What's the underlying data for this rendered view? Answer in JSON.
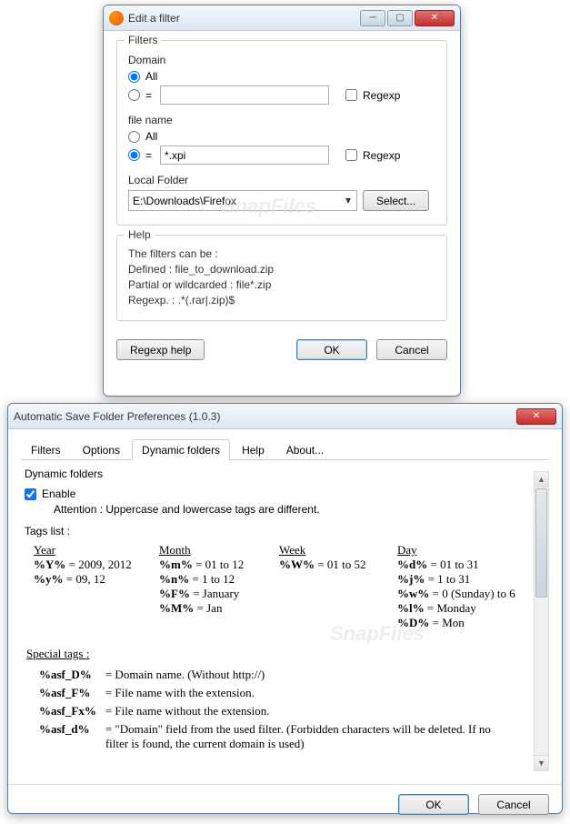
{
  "window1": {
    "title": "Edit a filter",
    "fieldset": "Filters",
    "domain_label": "Domain",
    "radio_all": "All",
    "domain_value": "",
    "regexp_label": "Regexp",
    "filename_label": "file name",
    "filename_value": "*.xpi",
    "folder_label": "Local Folder",
    "folder_value": "E:\\Downloads\\Firefox",
    "select_btn": "Select...",
    "help_legend": "Help",
    "help1": "The filters can be :",
    "help2": "Defined : file_to_download.zip",
    "help3": "Partial or wildcarded : file*.zip",
    "help4": "Regexp. : .*(.rar|.zip)$",
    "regexp_help_btn": "Regexp help",
    "ok": "OK",
    "cancel": "Cancel"
  },
  "window2": {
    "title": "Automatic Save Folder Preferences (1.0.3)",
    "tabs": [
      "Filters",
      "Options",
      "Dynamic folders",
      "Help",
      "About..."
    ],
    "active_tab": 2,
    "content_title": "Dynamic folders",
    "enable": "Enable",
    "attention": "Attention : Uppercase and lowercase tags are different.",
    "tags_list": "Tags list :",
    "year_head": "Year",
    "year_lines": [
      "%Y% = 2009, 2012",
      "%y% = 09, 12"
    ],
    "month_head": "Month",
    "month_lines": [
      "%m% = 01 to 12",
      "%n% = 1 to 12",
      "%F% = January",
      "%M% = Jan"
    ],
    "week_head": "Week",
    "week_lines": [
      "%W% = 01 to 52"
    ],
    "day_head": "Day",
    "day_lines": [
      "%d% = 01 to 31",
      "%j% = 1 to 31",
      "%w% = 0 (Sunday) to 6",
      "%l% = Monday",
      "%D% = Mon"
    ],
    "special_head": "Special tags :",
    "special": [
      {
        "tag": "%asf_D%",
        "desc": "= Domain name. (Without http://)"
      },
      {
        "tag": "%asf_F%",
        "desc": "= File name with the extension."
      },
      {
        "tag": "%asf_Fx%",
        "desc": "= File name without the extension."
      },
      {
        "tag": "%asf_d%",
        "desc": "= \"Domain\" field from the used filter. (Forbidden characters will be deleted. If no filter is found, the current domain is used)"
      }
    ],
    "ok": "OK",
    "cancel": "Cancel"
  }
}
